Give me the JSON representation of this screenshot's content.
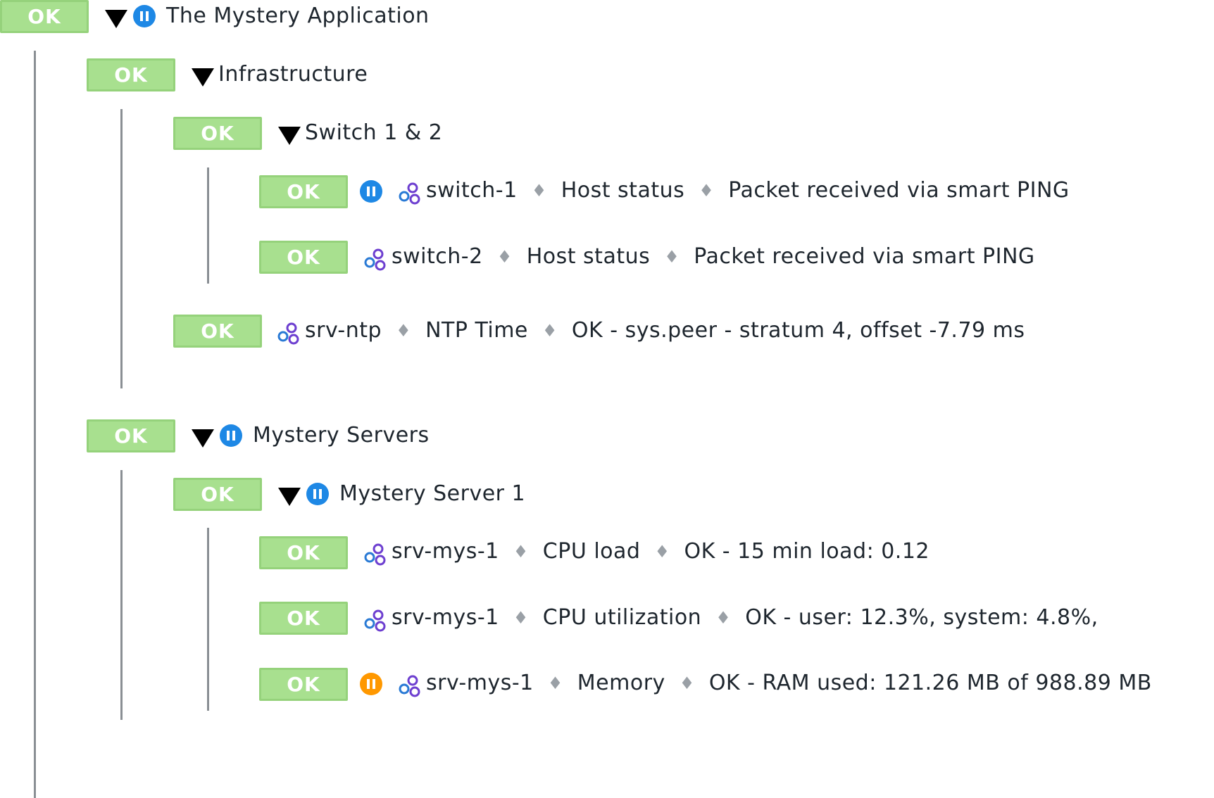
{
  "colors": {
    "ok_bg": "#a8e08f",
    "ok_border": "#95d27b",
    "pause_blue": "#1e88e5",
    "pause_orange": "#ff9800",
    "separator": "#9aa0a6"
  },
  "status_label": "OK",
  "separator_glyph": "♦",
  "tree": {
    "root": {
      "title": "The Mystery Application",
      "icon": "pause-icon-blue"
    },
    "infrastructure": {
      "title": "Infrastructure"
    },
    "switch_group": {
      "title": "Switch 1 & 2"
    },
    "switch_1": {
      "host": "switch-1",
      "service": "Host status",
      "output": "Packet received via smart PING",
      "icon": "pause-icon-blue"
    },
    "switch_2": {
      "host": "switch-2",
      "service": "Host status",
      "output": "Packet received via smart PING"
    },
    "srv_ntp": {
      "host": "srv-ntp",
      "service": "NTP Time",
      "output": "OK - sys.peer - stratum 4, offset -7.79 ms"
    },
    "mystery_servers": {
      "title": "Mystery Servers",
      "icon": "pause-icon-blue"
    },
    "mystery_server_1": {
      "title": "Mystery Server 1",
      "icon": "pause-icon-blue"
    },
    "cpu_load": {
      "host": "srv-mys-1",
      "service": "CPU load",
      "output": "OK - 15 min load: 0.12"
    },
    "cpu_util": {
      "host": "srv-mys-1",
      "service": "CPU utilization",
      "output": "OK - user: 12.3%, system: 4.8%,"
    },
    "memory": {
      "host": "srv-mys-1",
      "service": "Memory",
      "output": "OK - RAM used: 121.26 MB of 988.89 MB",
      "icon": "pause-icon-orange"
    }
  }
}
